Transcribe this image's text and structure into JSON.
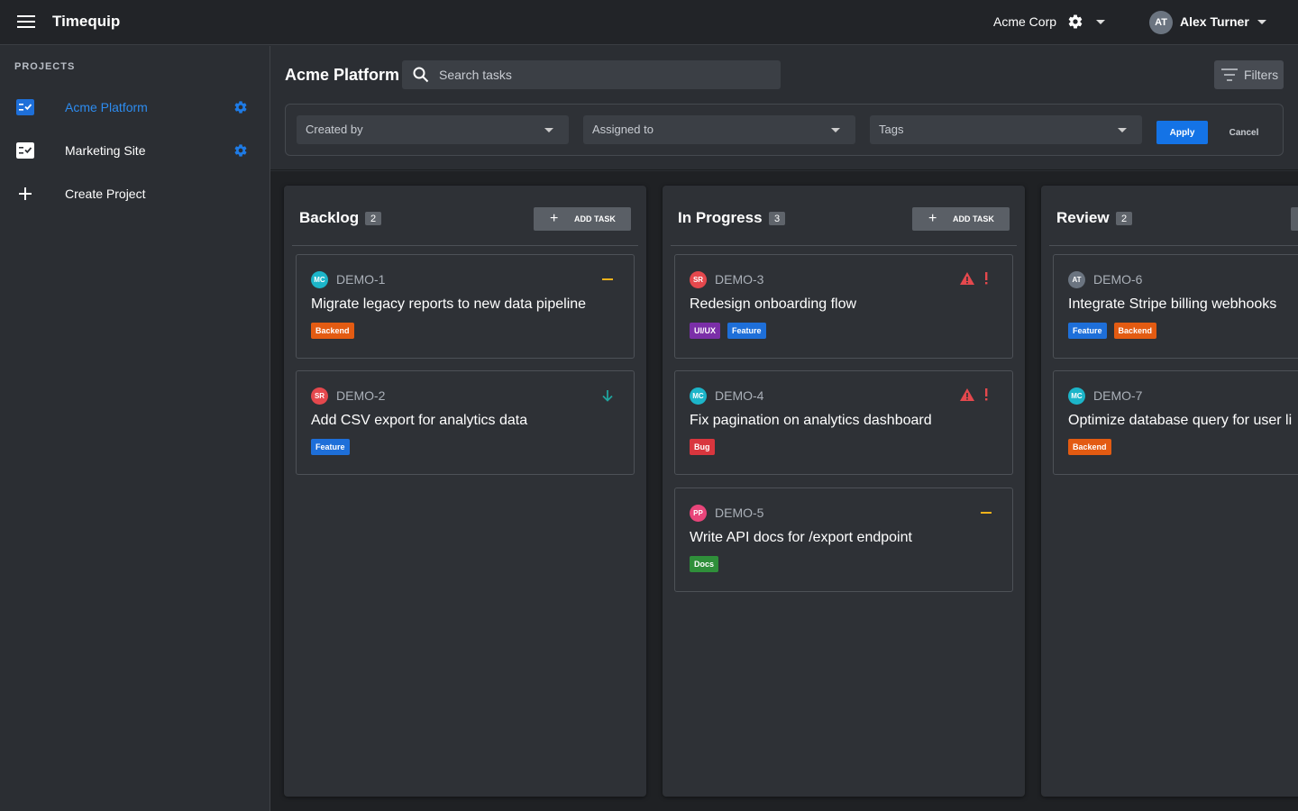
{
  "app": {
    "title": "Timequip"
  },
  "header": {
    "org_name": "Acme Corp",
    "user_initials": "AT",
    "user_name": "Alex Turner"
  },
  "sidebar": {
    "heading": "PROJECTS",
    "items": [
      {
        "label": "Acme Platform",
        "active": true
      },
      {
        "label": "Marketing Site",
        "active": false
      }
    ],
    "create_label": "Create Project"
  },
  "main": {
    "project_title": "Acme Platform",
    "search_placeholder": "Search tasks",
    "filters_label": "Filters",
    "filter_panel": {
      "created_by": "Created by",
      "assigned_to": "Assigned to",
      "tags": "Tags",
      "apply": "Apply",
      "cancel": "Cancel"
    }
  },
  "colors": {
    "accent": "#1473e6",
    "tag_backend": "#e35b12",
    "tag_feature": "#1e6fd9",
    "tag_uiux": "#7b2fa8",
    "tag_bug": "#d9363e",
    "tag_docs": "#2f8f3a",
    "priority_high": "#e5484d",
    "priority_medium": "#f2b21b",
    "priority_low": "#20a39e"
  },
  "board": {
    "add_task_label": "ADD TASK",
    "columns": [
      {
        "title": "Backlog",
        "count": "2",
        "cards": [
          {
            "id": "DEMO-1",
            "avatar": "MC",
            "avatar_color": "#1cb5c9",
            "title": "Migrate legacy reports to new data pipeline",
            "priority": "medium",
            "tags": [
              {
                "label": "Backend",
                "color": "#e35b12"
              }
            ]
          },
          {
            "id": "DEMO-2",
            "avatar": "SR",
            "avatar_color": "#e5484d",
            "title": "Add CSV export for analytics data",
            "priority": "low",
            "tags": [
              {
                "label": "Feature",
                "color": "#1e6fd9"
              }
            ]
          }
        ]
      },
      {
        "title": "In Progress",
        "count": "3",
        "cards": [
          {
            "id": "DEMO-3",
            "avatar": "SR",
            "avatar_color": "#e5484d",
            "title": "Redesign onboarding flow",
            "priority": "high",
            "tags": [
              {
                "label": "UI/UX",
                "color": "#7b2fa8"
              },
              {
                "label": "Feature",
                "color": "#1e6fd9"
              }
            ]
          },
          {
            "id": "DEMO-4",
            "avatar": "MC",
            "avatar_color": "#1cb5c9",
            "title": "Fix pagination on analytics dashboard",
            "priority": "high",
            "tags": [
              {
                "label": "Bug",
                "color": "#d9363e"
              }
            ]
          },
          {
            "id": "DEMO-5",
            "avatar": "PP",
            "avatar_color": "#e8457a",
            "title": "Write API docs for /export endpoint",
            "priority": "medium",
            "tags": [
              {
                "label": "Docs",
                "color": "#2f8f3a"
              }
            ]
          }
        ]
      },
      {
        "title": "Review",
        "count": "2",
        "cards": [
          {
            "id": "DEMO-6",
            "avatar": "AT",
            "avatar_color": "#6b7480",
            "title": "Integrate Stripe billing webhooks",
            "priority": "none",
            "tags": [
              {
                "label": "Feature",
                "color": "#1e6fd9"
              },
              {
                "label": "Backend",
                "color": "#e35b12"
              }
            ]
          },
          {
            "id": "DEMO-7",
            "avatar": "MC",
            "avatar_color": "#1cb5c9",
            "title": "Optimize database query for user li",
            "priority": "none",
            "tags": [
              {
                "label": "Backend",
                "color": "#e35b12"
              }
            ]
          }
        ]
      }
    ]
  }
}
